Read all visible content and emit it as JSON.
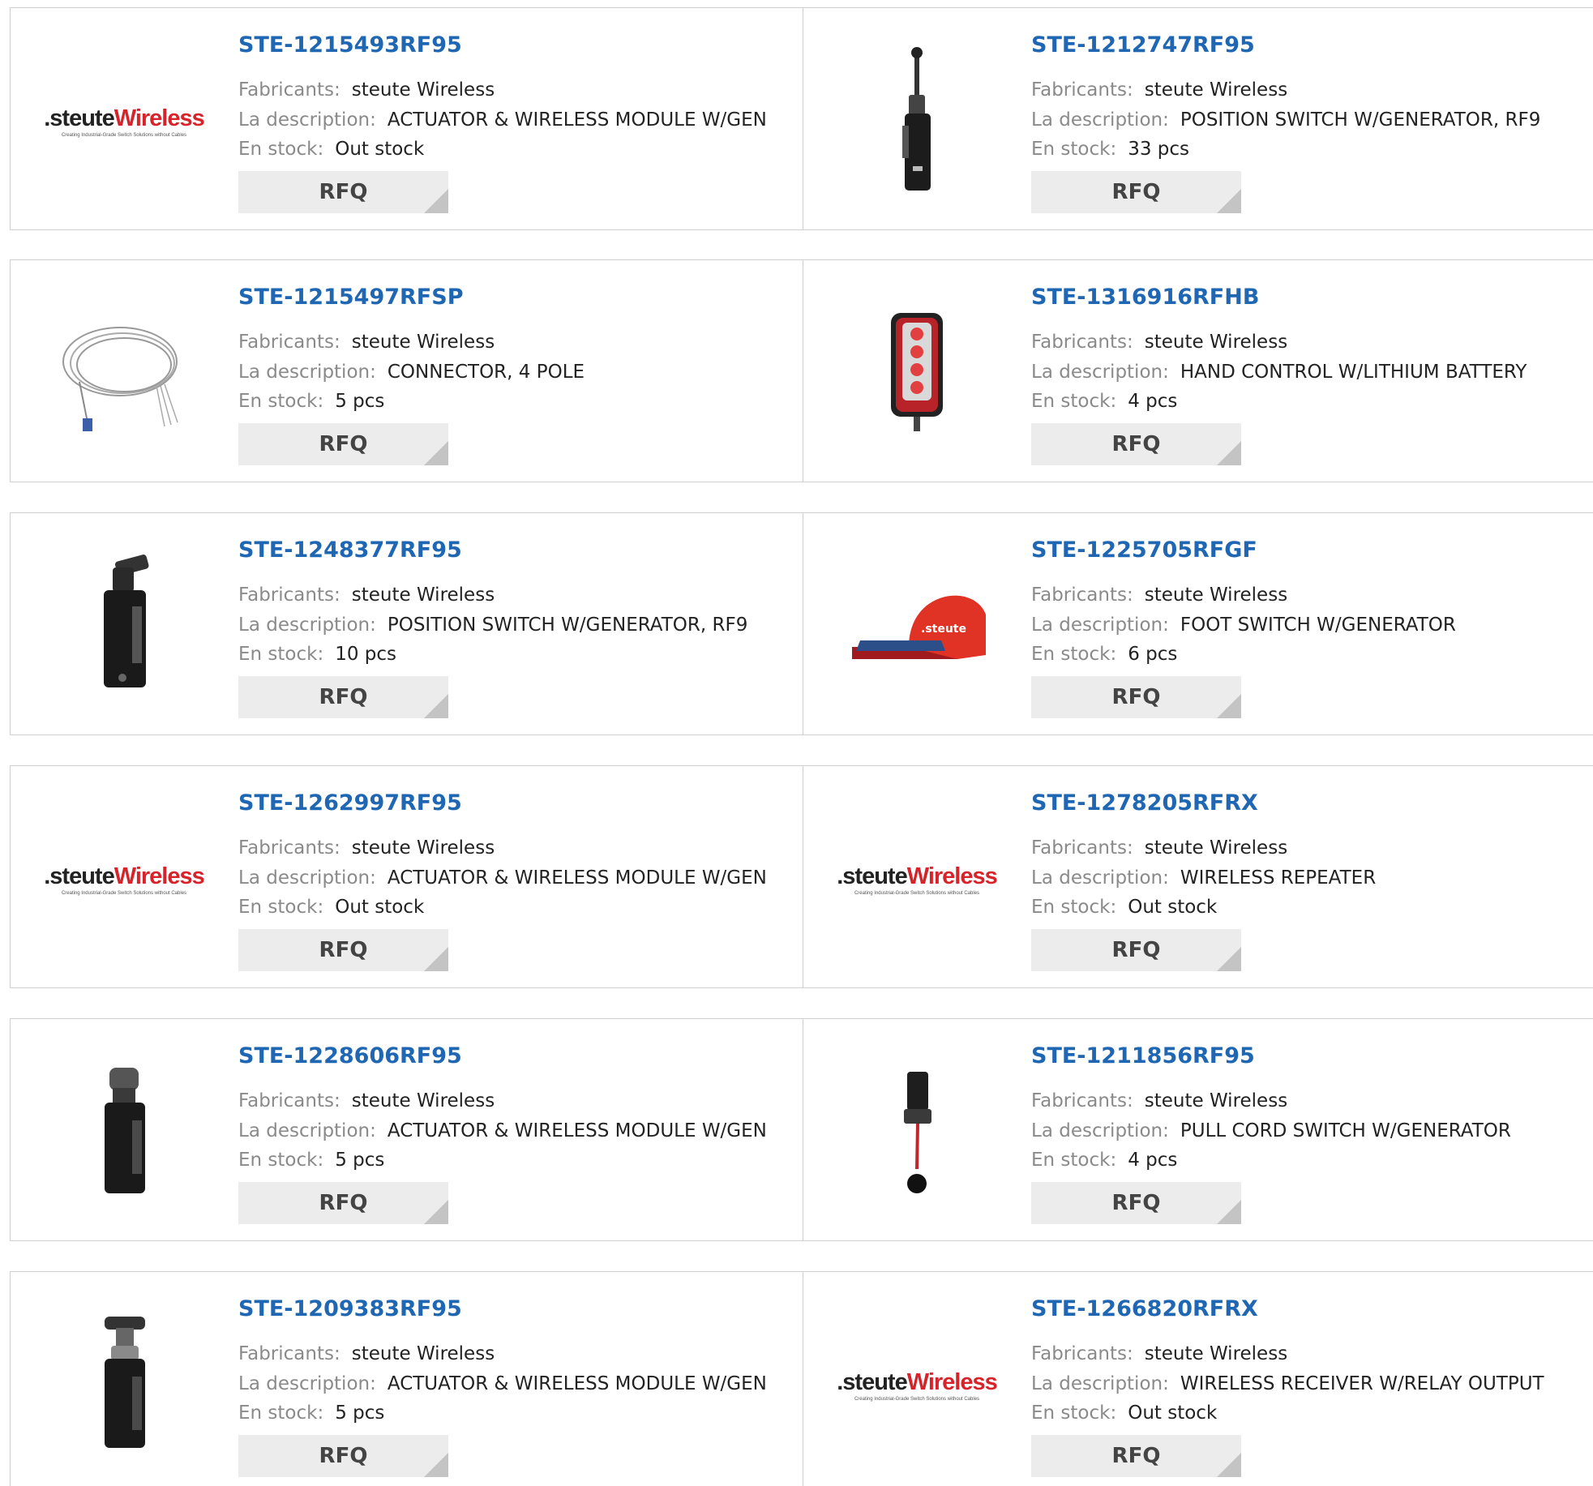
{
  "labels": {
    "manufacturer": "Fabricants:",
    "description": "La description:",
    "stock": "En stock:",
    "rfq": "RFQ"
  },
  "logo": {
    "dot": ".",
    "steute": "steute",
    "wireless": "Wireless",
    "tagline": "Creating Industrial-Grade Switch Solutions without Cables"
  },
  "colors": {
    "part_link": "#1f66b3",
    "brand_red": "#d8232a",
    "button_bg": "#ececec"
  },
  "products": [
    {
      "part": "STE-1215493RF95",
      "manufacturer": "steute Wireless",
      "description": "ACTUATOR & WIRELESS MODULE W/GEN",
      "stock": "Out stock",
      "image": "steute-wireless-logo"
    },
    {
      "part": "STE-1212747RF95",
      "manufacturer": "steute Wireless",
      "description": "POSITION SWITCH W/GENERATOR, RF9",
      "stock": "33 pcs",
      "image": "rod-lever-position-switch"
    },
    {
      "part": "STE-1215497RFSP",
      "manufacturer": "steute Wireless",
      "description": "CONNECTOR, 4 POLE",
      "stock": "5 pcs",
      "image": "coiled-cable-connector"
    },
    {
      "part": "STE-1316916RFHB",
      "manufacturer": "steute Wireless",
      "description": "HAND CONTROL W/LITHIUM BATTERY",
      "stock": "4 pcs",
      "image": "hand-control-remote"
    },
    {
      "part": "STE-1248377RF95",
      "manufacturer": "steute Wireless",
      "description": "POSITION SWITCH W/GENERATOR, RF9",
      "stock": "10 pcs",
      "image": "roller-position-switch"
    },
    {
      "part": "STE-1225705RFGF",
      "manufacturer": "steute Wireless",
      "description": "FOOT SWITCH W/GENERATOR",
      "stock": "6 pcs",
      "image": "red-foot-switch"
    },
    {
      "part": "STE-1262997RF95",
      "manufacturer": "steute Wireless",
      "description": "ACTUATOR & WIRELESS MODULE W/GEN",
      "stock": "Out stock",
      "image": "steute-wireless-logo"
    },
    {
      "part": "STE-1278205RFRX",
      "manufacturer": "steute Wireless",
      "description": "WIRELESS REPEATER",
      "stock": "Out stock",
      "image": "steute-wireless-logo"
    },
    {
      "part": "STE-1228606RF95",
      "manufacturer": "steute Wireless",
      "description": "ACTUATOR & WIRELESS MODULE W/GEN",
      "stock": "5 pcs",
      "image": "plunger-actuator-module"
    },
    {
      "part": "STE-1211856RF95",
      "manufacturer": "steute Wireless",
      "description": "PULL CORD SWITCH W/GENERATOR",
      "stock": "4 pcs",
      "image": "pull-cord-switch"
    },
    {
      "part": "STE-1209383RF95",
      "manufacturer": "steute Wireless",
      "description": "ACTUATOR & WIRELESS MODULE W/GEN",
      "stock": "5 pcs",
      "image": "mushroom-actuator-module"
    },
    {
      "part": "STE-1266820RFRX",
      "manufacturer": "steute Wireless",
      "description": "WIRELESS RECEIVER W/RELAY OUTPUT",
      "stock": "Out stock",
      "image": "steute-wireless-logo"
    }
  ]
}
